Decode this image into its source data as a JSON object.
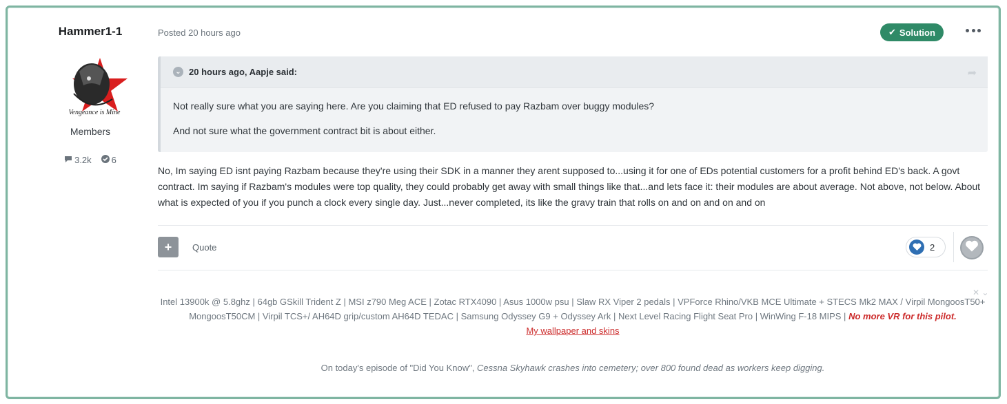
{
  "author": {
    "name": "Hammer1-1",
    "group": "Members",
    "posts": "3.2k",
    "solutions": "6",
    "avatar_text": "Vengeance is Mine"
  },
  "post": {
    "posted": "Posted 20 hours ago",
    "solution_label": "Solution",
    "quote": {
      "header": "20 hours ago, Aapje said:",
      "lines": [
        "Not really sure what you are saying here. Are you claiming that ED refused to pay Razbam over buggy modules?",
        "And not sure what the government contract bit is about either."
      ]
    },
    "body": "No, Im saying ED isnt paying Razbam because they're using their SDK in a manner they arent supposed to...using it for one of EDs potential customers for a profit behind ED's back. A govt contract. Im saying if Razbam's modules were top quality, they could probably get away with small things like that...and lets face it: their modules are about average. Not above, not below. About what is expected of you if you punch a clock every single day. Just...never completed, its like the gravy train that rolls on and on and on and on"
  },
  "actions": {
    "quote_label": "Quote",
    "reaction_count": "2"
  },
  "signature": {
    "specs": "Intel 13900k @ 5.8ghz | 64gb GSkill Trident Z | MSI z790 Meg ACE | Zotac RTX4090 | Asus 1000w psu | Slaw RX Viper 2 pedals | VPForce Rhino/VKB MCE Ultimate + STECS Mk2  MAX / Virpil MongoosT50+ MongoosT50CM | Virpil TCS+/ AH64D grip/custom AH64D TEDAC | Samsung Odyssey G9 + Odyssey Ark | Next Level Racing Flight Seat Pro | WinWing F-18 MIPS |",
    "no_vr": "No more VR for this pilot.",
    "wallpaper_link": "My wallpaper and skins",
    "did_you_know_prefix": "On today's episode of \"Did You Know\",",
    "did_you_know_italic": "Cessna Skyhawk crashes into cemetery; over 800 found dead as workers keep digging."
  },
  "colors": {
    "accent_green": "#2f8a67",
    "reaction_blue": "#2f6fb3",
    "signature_red": "#cc2b2b"
  }
}
